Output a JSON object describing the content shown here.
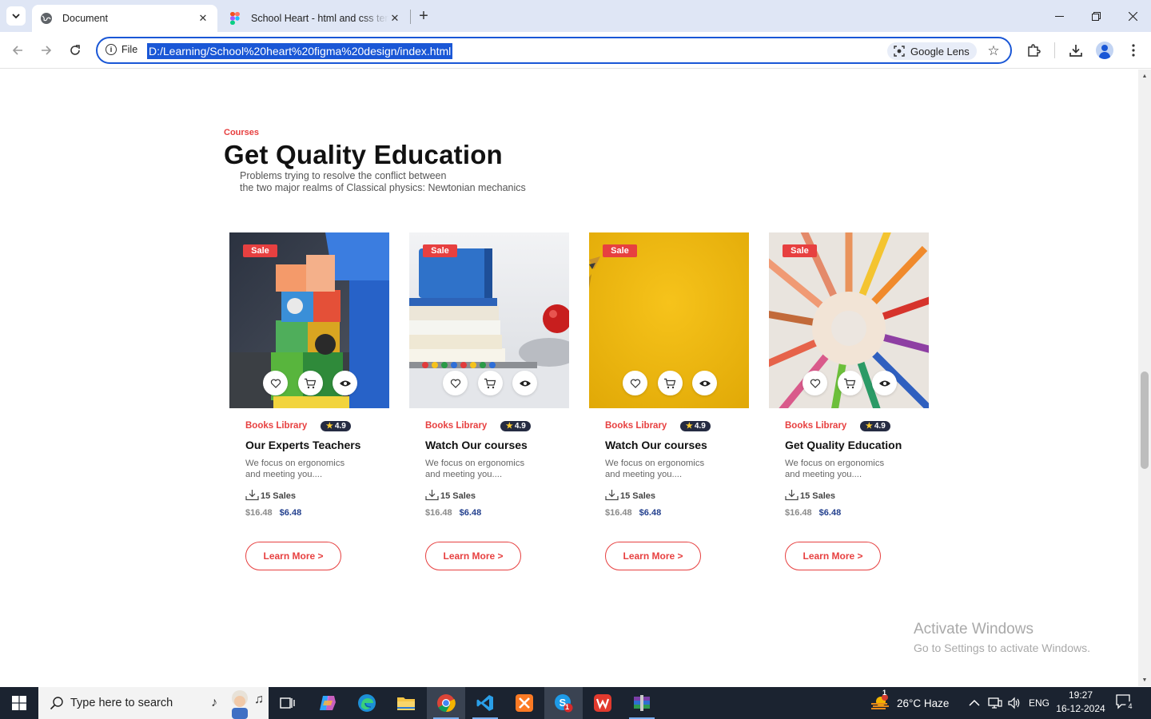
{
  "browser": {
    "tabs": [
      {
        "title": "Document",
        "active": true,
        "favicon": "globe-icon"
      },
      {
        "title": "School Heart - html and css template",
        "active": false,
        "favicon": "figma-icon"
      }
    ],
    "address": {
      "scheme_label": "File",
      "url": "D:/Learning/School%20heart%20figma%20design/index.html"
    },
    "lens_label": "Google Lens"
  },
  "page": {
    "section_tag": "Courses",
    "section_title": "Get Quality Education",
    "description_lines": [
      "Problems trying to resolve the conflict between",
      "the two major realms of Classical physics: Newtonian mechanics"
    ],
    "cards": [
      {
        "image": "toy-blocks-photo",
        "sale_label": "Sale",
        "category": "Books Library",
        "rating": "4.9",
        "title": "Our Experts Teachers",
        "description_lines": [
          "We focus on ergonomics",
          "and meeting you...."
        ],
        "sales": "15 Sales",
        "old_price": "$16.48",
        "new_price": "$6.48",
        "button_label": "Learn More >"
      },
      {
        "image": "books-apple-photo",
        "sale_label": "Sale",
        "category": "Books Library",
        "rating": "4.9",
        "title": "Watch Our courses",
        "description_lines": [
          "We focus on ergonomics",
          "and meeting you...."
        ],
        "sales": "15 Sales",
        "old_price": "$16.48",
        "new_price": "$6.48",
        "button_label": "Learn More >"
      },
      {
        "image": "yellow-pencil-photo",
        "sale_label": "Sale",
        "category": "Books Library",
        "rating": "4.9",
        "title": "Watch Our courses",
        "description_lines": [
          "We focus on ergonomics",
          "and meeting you...."
        ],
        "sales": "15 Sales",
        "old_price": "$16.48",
        "new_price": "$6.48",
        "button_label": "Learn More >"
      },
      {
        "image": "colored-pencils-photo",
        "sale_label": "Sale",
        "category": "Books Library",
        "rating": "4.9",
        "title": "Get Quality Education",
        "description_lines": [
          "We focus on ergonomics",
          "and meeting you...."
        ],
        "sales": "15 Sales",
        "old_price": "$16.48",
        "new_price": "$6.48",
        "button_label": "Learn More >"
      }
    ],
    "watermark": {
      "title": "Activate Windows",
      "subtitle": "Go to Settings to activate Windows."
    }
  },
  "taskbar": {
    "search_placeholder": "Type here to search",
    "weather_badge": "1",
    "weather_text": "26°C  Haze",
    "language": "ENG",
    "time": "19:27",
    "date": "16-12-2024",
    "notification_count": "4",
    "skype_badge": "1"
  },
  "colors": {
    "accent": "#e74040",
    "price_blue": "#23408e",
    "rating_bg": "#252b42",
    "address_highlight": "#1a57d6"
  }
}
